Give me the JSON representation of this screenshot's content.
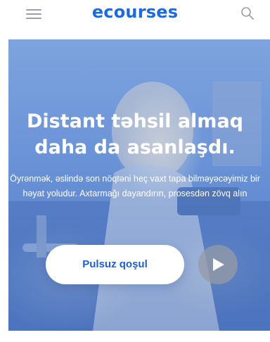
{
  "header": {
    "brand": "ecourses",
    "menu_icon": "hamburger-menu-icon",
    "search_icon": "search-icon"
  },
  "hero": {
    "title_line1": "Distant təhsil almaq",
    "title_line2": "daha da asanlaşdı.",
    "subtitle": "Öyrənmək, əslində son nöqtəni heç vaxt tapa bilməyəcəyimiz bir həyat yoludur. Axtarmağı dayandırın, prosesdən zövq alın",
    "cta_label": "Pulsuz qoşul",
    "play_icon": "play-icon"
  },
  "colors": {
    "brand": "#1c6bdc",
    "hero_overlay": "#6d95d8",
    "cta_text": "#1f5fcf"
  }
}
